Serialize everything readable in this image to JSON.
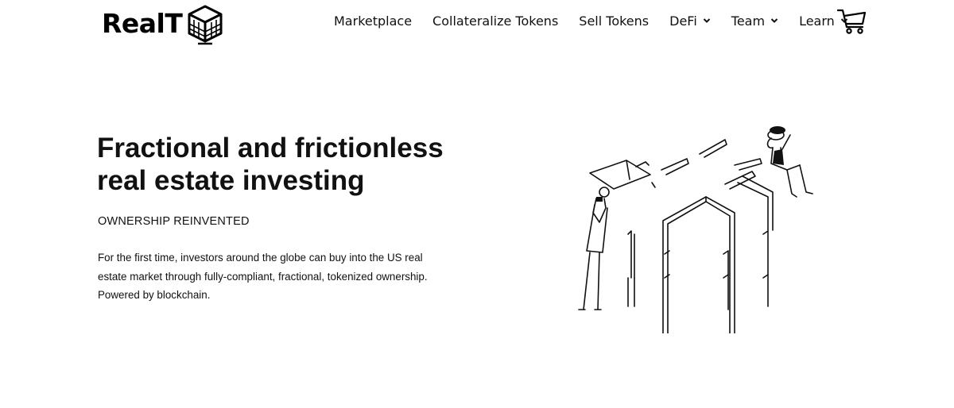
{
  "header": {
    "logo_text": "RealT",
    "nav": [
      {
        "label": "Marketplace",
        "dropdown": false
      },
      {
        "label": "Collateralize Tokens",
        "dropdown": false
      },
      {
        "label": "Sell Tokens",
        "dropdown": false
      },
      {
        "label": "DeFi",
        "dropdown": true
      },
      {
        "label": "Team",
        "dropdown": true
      },
      {
        "label": "Learn",
        "dropdown": true
      }
    ],
    "cart_icon": "shopping-cart-icon"
  },
  "hero": {
    "title_line1": "Fractional and frictionless",
    "title_line2": "real estate investing",
    "kicker": "OWNERSHIP REINVENTED",
    "body_line1": "For the first time, investors around the globe can buy into the US real",
    "body_line2": "estate market through fully-compliant, fractional, tokenized ownership.",
    "body_line3": "Powered by blockchain.",
    "illustration": "people-building-illustration"
  },
  "colors": {
    "text": "#111111",
    "background": "#ffffff"
  }
}
